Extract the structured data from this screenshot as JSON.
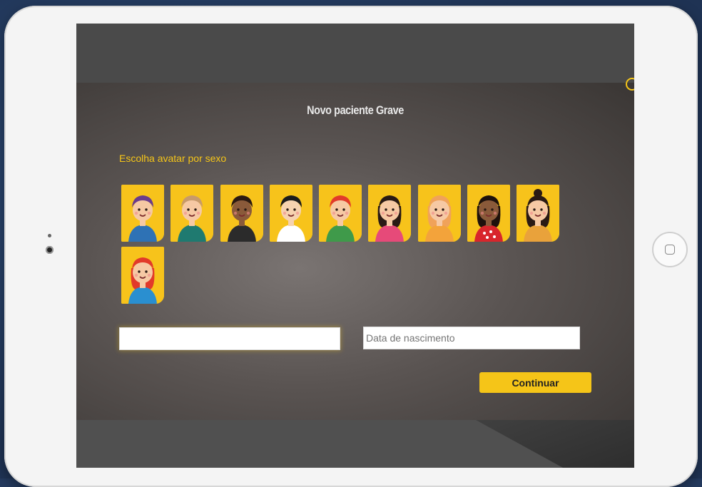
{
  "screen": {
    "title": "Novo paciente Grave",
    "section_label": "Escolha avatar por sexo"
  },
  "avatars": [
    {
      "id": "boy-purple-hair",
      "hair": "#6a3c8c",
      "skin": "#f6c9a4",
      "shirt": "#2e72b5"
    },
    {
      "id": "boy-light-hair",
      "hair": "#c79a6b",
      "skin": "#f6c9a4",
      "shirt": "#1f7a70"
    },
    {
      "id": "boy-dark-skin",
      "hair": "#2b1a12",
      "skin": "#8a5a3a",
      "shirt": "#2b2b2b"
    },
    {
      "id": "boy-black-hair",
      "hair": "#1c1c1c",
      "skin": "#f6d2b0",
      "shirt": "#ffffff"
    },
    {
      "id": "boy-red-hair",
      "hair": "#e23a2a",
      "skin": "#f6c9a4",
      "shirt": "#3f9a4a"
    },
    {
      "id": "girl-ponytail",
      "hair": "#2a1a14",
      "skin": "#f6c9a4",
      "shirt": "#e64a79"
    },
    {
      "id": "girl-blonde",
      "hair": "#f0a25a",
      "skin": "#f6c9a4",
      "shirt": "#f3a33b"
    },
    {
      "id": "girl-dark-skin",
      "hair": "#1e110c",
      "skin": "#8a5a3a",
      "shirt": "#d8262c"
    },
    {
      "id": "girl-bun",
      "hair": "#2a1a14",
      "skin": "#f6c9a4",
      "shirt": "#e9a23b"
    },
    {
      "id": "girl-red-hair",
      "hair": "#e23a2a",
      "skin": "#f6c9a4",
      "shirt": "#2a8fd0"
    }
  ],
  "form": {
    "name_value": "",
    "date_placeholder": "Data de nascimento",
    "continue_label": "Continuar"
  },
  "colors": {
    "accent": "#f5c518",
    "avatar_bg": "#f7c31b"
  },
  "icons": {
    "close": "close-icon",
    "home": "home-button-icon"
  }
}
